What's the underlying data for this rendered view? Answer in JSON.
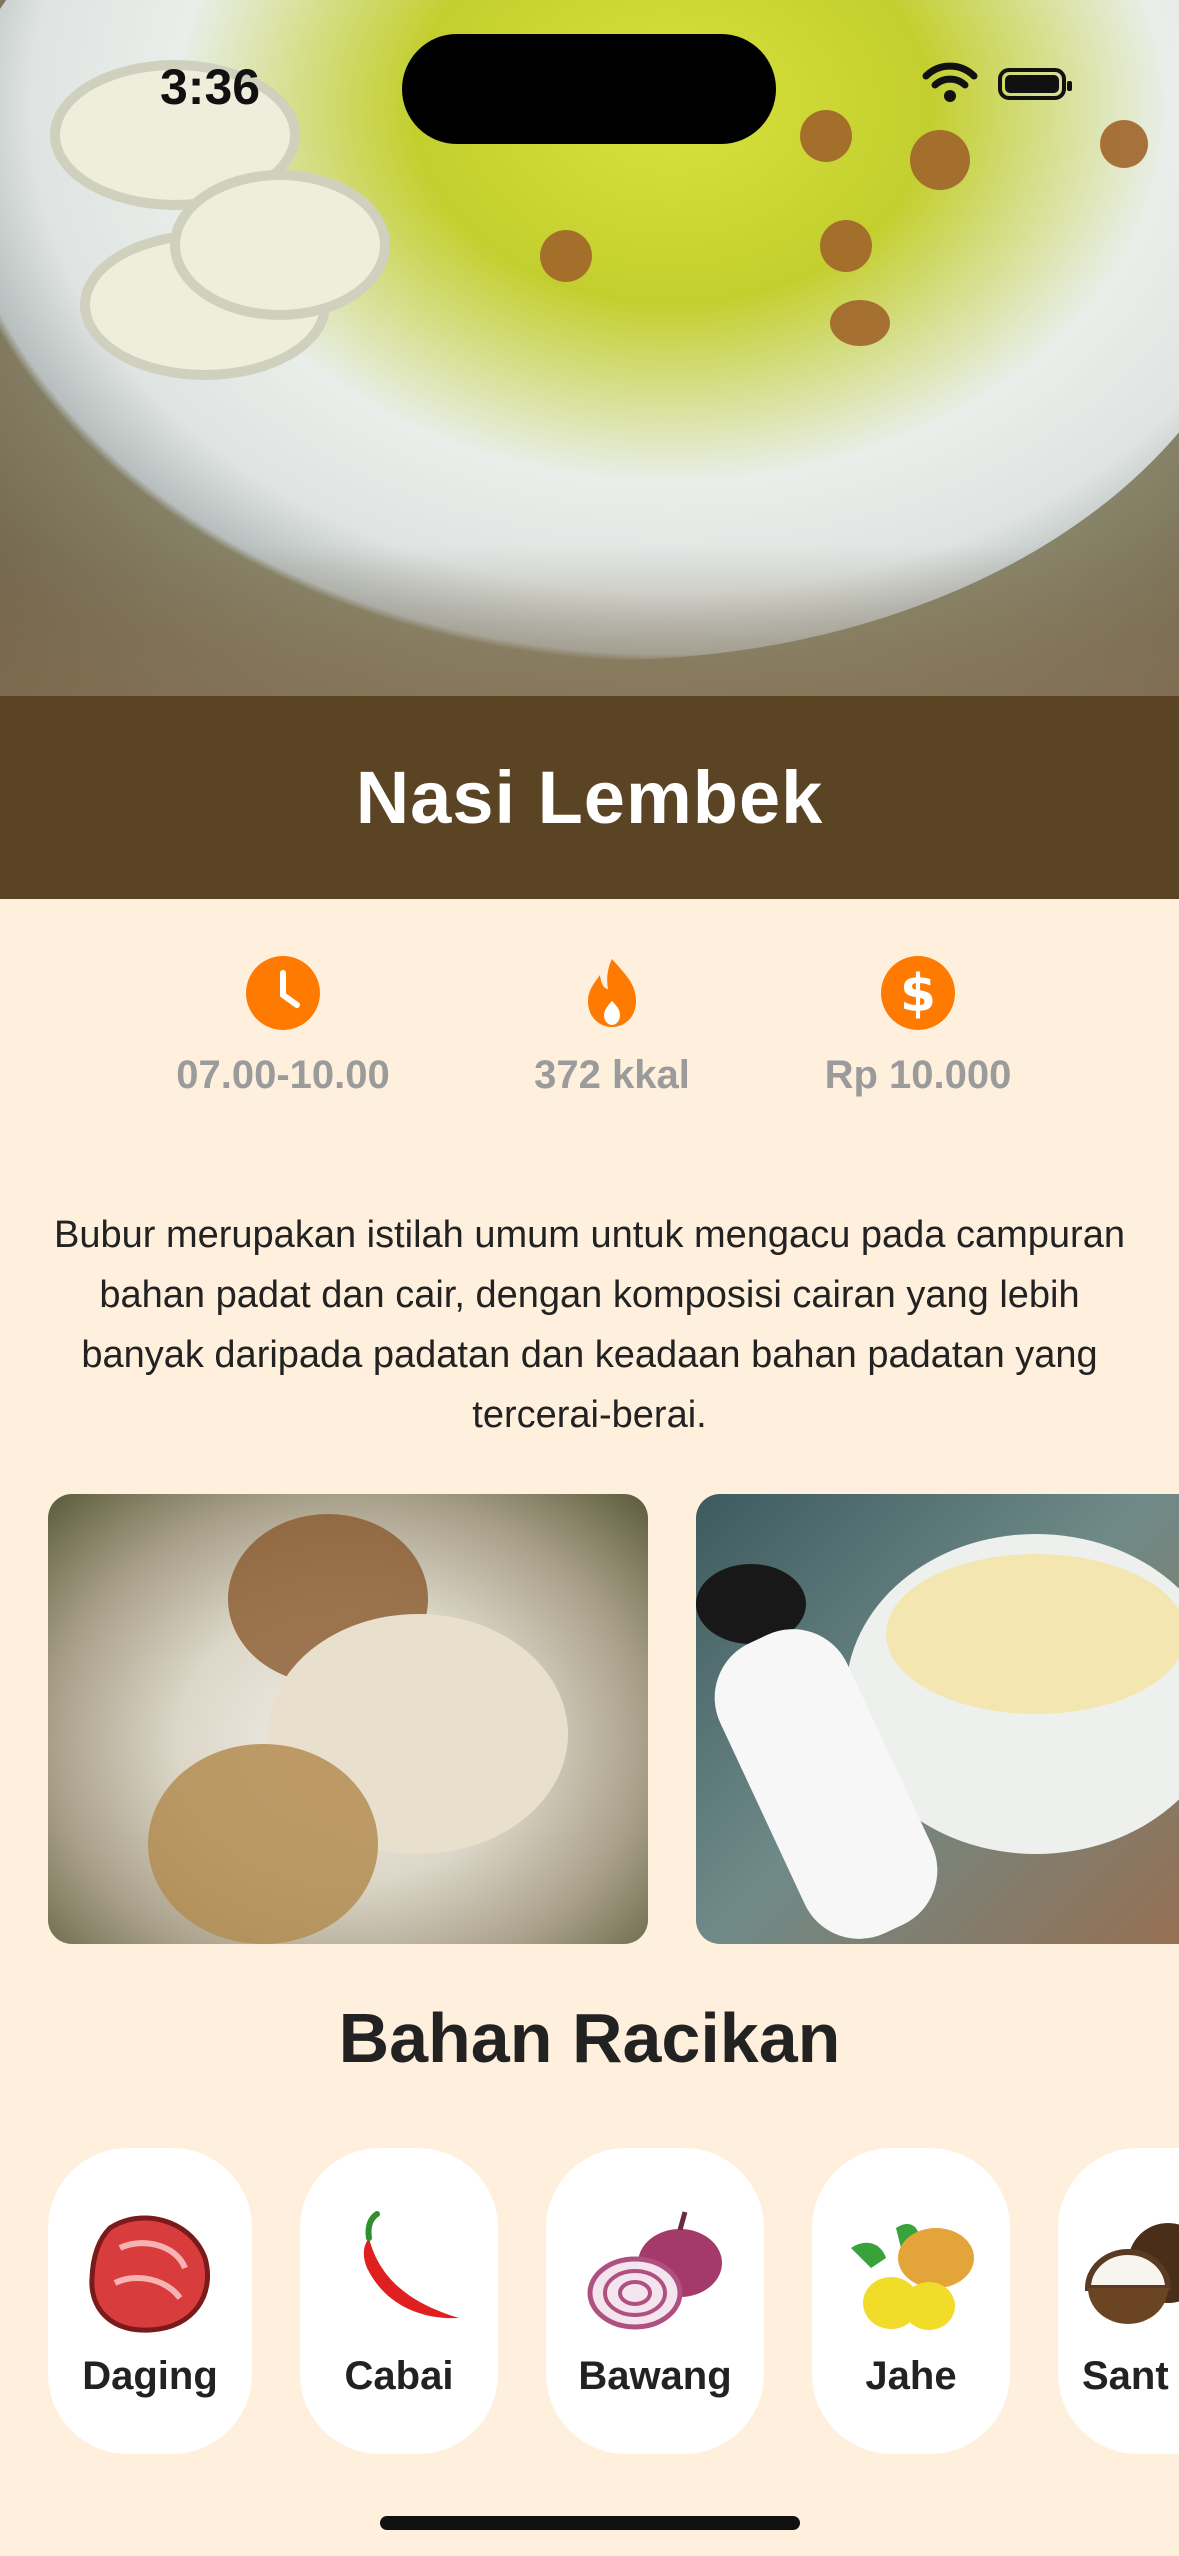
{
  "status_bar": {
    "time": "3:36"
  },
  "hero": {
    "image_alt": "Nasi Lembek bowl"
  },
  "title": "Nasi Lembek",
  "stats": [
    {
      "icon": "clock-icon",
      "value": "07.00-10.00"
    },
    {
      "icon": "fire-icon",
      "value": "372 kkal"
    },
    {
      "icon": "dollar-icon",
      "value": "Rp 10.000"
    }
  ],
  "description": "Bubur merupakan istilah umum untuk mengacu pada campuran bahan padat dan cair, dengan komposisi cairan yang lebih banyak daripada padatan dan keadaan bahan padatan yang tercerai-berai.",
  "section_title": "Bahan Racikan",
  "ingredients": [
    {
      "label": "Daging",
      "icon": "meat-icon"
    },
    {
      "label": "Cabai",
      "icon": "chili-icon"
    },
    {
      "label": "Bawang",
      "icon": "onion-icon"
    },
    {
      "label": "Jahe",
      "icon": "ginger-icon"
    },
    {
      "label": "Sant",
      "icon": "coconut-icon"
    }
  ],
  "colors": {
    "accent": "#FF7A00",
    "header_bg": "#5B4423",
    "page_bg": "#FEF0DD"
  }
}
